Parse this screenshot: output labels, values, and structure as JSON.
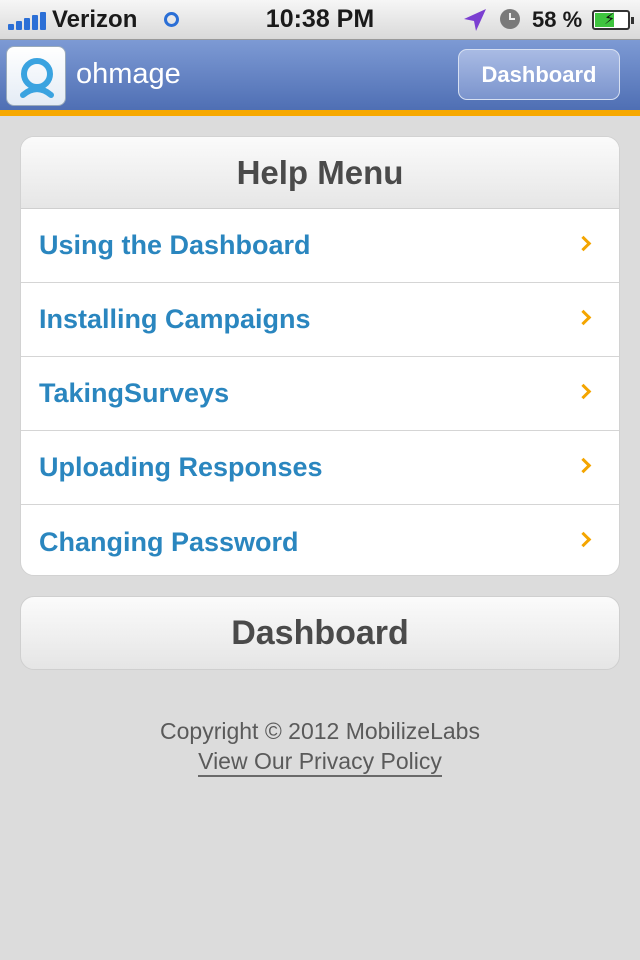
{
  "status_bar": {
    "carrier": "Verizon",
    "time": "10:38 PM",
    "battery_percent": "58 %",
    "battery_level": 0.58,
    "icons": [
      "signal-icon",
      "wifi-icon",
      "location-arrow-icon",
      "alarm-clock-icon",
      "battery-charging-icon"
    ]
  },
  "navbar": {
    "title": "ohmage",
    "dashboard_button": "Dashboard",
    "accent_color": "#f6a800"
  },
  "help_menu": {
    "title": "Help Menu",
    "items": [
      {
        "label": "Using the Dashboard"
      },
      {
        "label": "Installing Campaigns"
      },
      {
        "label": "TakingSurveys"
      },
      {
        "label": "Uploading Responses"
      },
      {
        "label": "Changing Password"
      }
    ],
    "link_color": "#2a86bf",
    "chevron_color": "#f4a500"
  },
  "dashboard_button": "Dashboard",
  "footer": {
    "copyright": "Copyright © 2012 MobilizeLabs",
    "privacy_link": "View Our Privacy Policy"
  }
}
